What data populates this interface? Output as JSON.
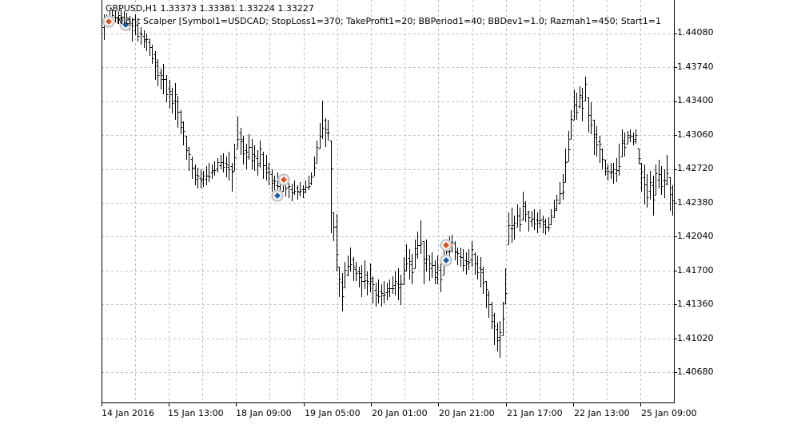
{
  "chart": {
    "symbol_info": "GBPUSD,H1  1.33373 1.33381 1.33224 1.33227",
    "ea_params": "Night Scalper [Symbol1=USDCAD; StopLoss1=370; TakeProfit1=20; BBPeriod1=40; BBDev1=1.0; Razmah1=450; Start1=1",
    "price_axis": [
      "1.44080",
      "1.43740",
      "1.43400",
      "1.43060",
      "1.42720",
      "1.42380",
      "1.42040",
      "1.41700",
      "1.41360",
      "1.41020",
      "1.40680"
    ],
    "time_axis": [
      "14 Jan 2016",
      "15 Jan 13:00",
      "18 Jan 09:00",
      "19 Jan 05:00",
      "20 Jan 01:00",
      "20 Jan 21:00",
      "21 Jan 17:00",
      "22 Jan 13:00",
      "25 Jan 09:00"
    ],
    "colors": {
      "background": "#ffffff",
      "grid": "#c0c0c0",
      "bars": "#000000",
      "buy_arrow": "#1f5fa8",
      "sell_arrow": "#e0501e",
      "marker_ring": "#c8c8c8"
    }
  }
}
